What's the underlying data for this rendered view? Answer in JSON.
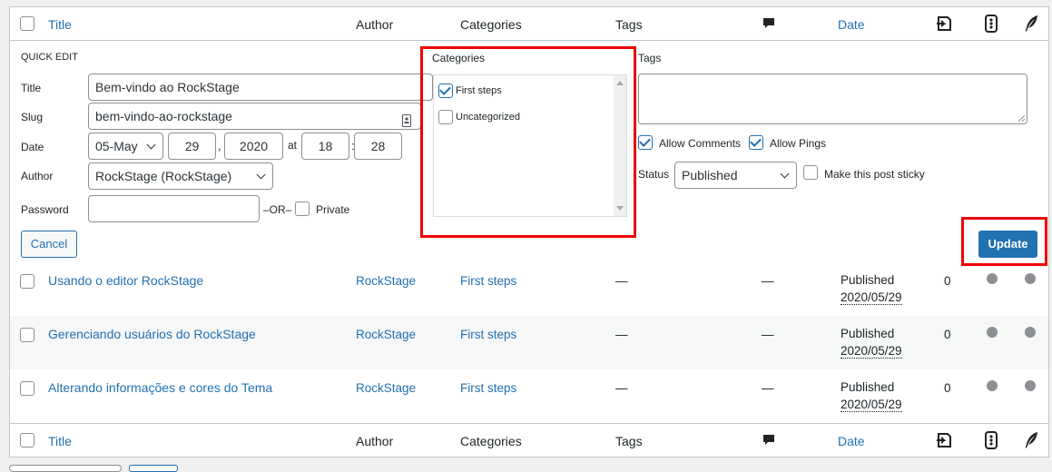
{
  "header": {
    "title": "Title",
    "author": "Author",
    "categories": "Categories",
    "tags": "Tags",
    "date": "Date"
  },
  "quick_edit": {
    "heading": "QUICK EDIT",
    "title_label": "Title",
    "title_value": "Bem-vindo ao RockStage",
    "slug_label": "Slug",
    "slug_value": "bem-vindo-ao-rockstage",
    "date_label": "Date",
    "month": "05-May",
    "day": "29",
    "comma": ",",
    "year": "2020",
    "at": "at",
    "hour": "18",
    "colon": ":",
    "minute": "28",
    "author_label": "Author",
    "author_value": "RockStage (RockStage)",
    "password_label": "Password",
    "password_value": "",
    "or": "–OR–",
    "private_label": "Private",
    "categories_label": "Categories",
    "categories": [
      {
        "label": "First steps",
        "checked": true
      },
      {
        "label": "Uncategorized",
        "checked": false
      }
    ],
    "tags_label": "Tags",
    "allow_comments": "Allow Comments",
    "allow_pings": "Allow Pings",
    "status_label": "Status",
    "status_value": "Published",
    "sticky_label": "Make this post sticky",
    "cancel": "Cancel",
    "update": "Update"
  },
  "posts": [
    {
      "title": "Usando o editor RockStage",
      "author": "RockStage",
      "category": "First steps",
      "tags": "—",
      "comments": "—",
      "status": "Published",
      "date": "2020/05/29",
      "count": "0"
    },
    {
      "title": "Gerenciando usuários do RockStage",
      "author": "RockStage",
      "category": "First steps",
      "tags": "—",
      "comments": "—",
      "status": "Published",
      "date": "2020/05/29",
      "count": "0"
    },
    {
      "title": "Alterando informações e cores do Tema",
      "author": "RockStage",
      "category": "First steps",
      "tags": "—",
      "comments": "—",
      "status": "Published",
      "date": "2020/05/29",
      "count": "0"
    }
  ],
  "colors": {
    "link": "#2271b1",
    "highlight": "#e00000"
  }
}
